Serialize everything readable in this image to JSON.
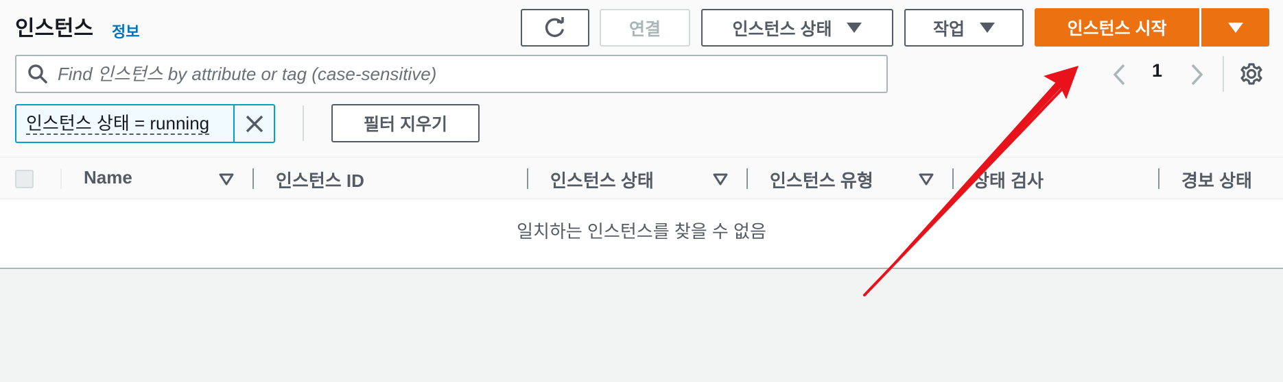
{
  "header": {
    "title": "인스턴스",
    "info_link": "정보"
  },
  "toolbar": {
    "refresh_icon": "refresh-icon",
    "connect_label": "연결",
    "instance_state_label": "인스턴스 상태",
    "actions_label": "작업",
    "launch_label": "인스턴스 시작"
  },
  "search": {
    "placeholder": "Find 인스턴스 by attribute or tag (case-sensitive)"
  },
  "pagination": {
    "current_page": "1"
  },
  "filters": {
    "active_token": "인스턴스 상태 = running",
    "clear_label": "필터 지우기"
  },
  "table": {
    "columns": [
      "Name",
      "인스턴스 ID",
      "인스턴스 상태",
      "인스턴스 유형",
      "상태 검사",
      "경보 상태"
    ],
    "empty_message": "일치하는 인스턴스를 찾을 수 없음"
  },
  "colors": {
    "primary": "#ec7211",
    "link": "#0073bb",
    "annotation_arrow": "#e8121a"
  }
}
